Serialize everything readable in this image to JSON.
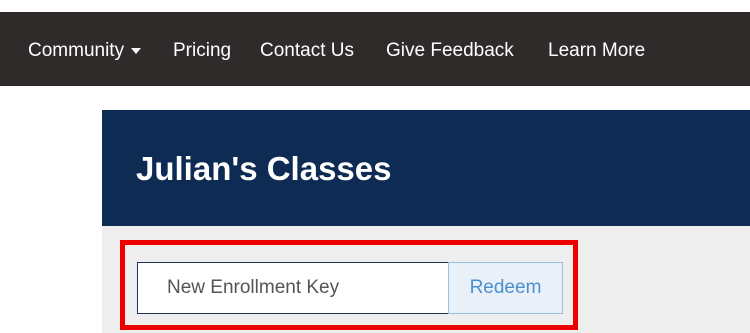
{
  "navbar": {
    "items": [
      {
        "label": "Community",
        "has_dropdown": true
      },
      {
        "label": "Pricing"
      },
      {
        "label": "Contact Us"
      },
      {
        "label": "Give Feedback"
      },
      {
        "label": "Learn More"
      }
    ],
    "background": "#2f2b2a"
  },
  "panel": {
    "title": "Julian's Classes",
    "header_color": "#0d2b53",
    "body_color": "#eeeeee"
  },
  "enrollment": {
    "placeholder": "New Enrollment Key",
    "redeem_label": "Redeem",
    "highlight_color": "#ee0000"
  }
}
